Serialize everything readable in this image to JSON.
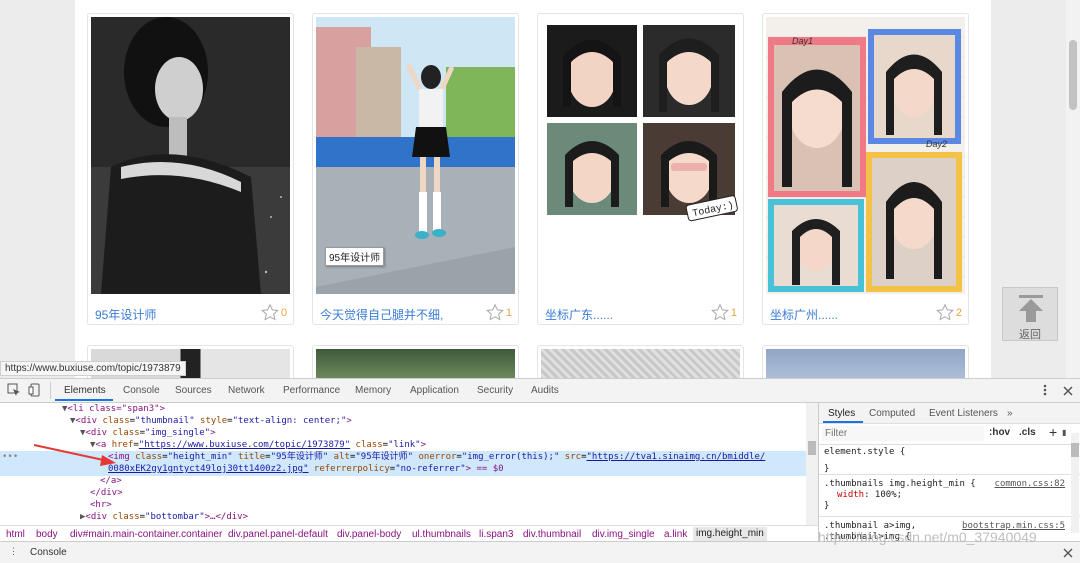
{
  "cards": [
    {
      "caption": "95年设计师",
      "count": "0"
    },
    {
      "caption": "今天觉得自己腿并不细,",
      "count": "1"
    },
    {
      "caption": "坐标广东......",
      "count": "1"
    },
    {
      "caption": "坐标广州......",
      "count": "2"
    }
  ],
  "tooltip": "95年设计师",
  "back_button": "返回",
  "status_url": "https://www.buxiuse.com/topic/1973879",
  "photo_text": {
    "day1": "Day1",
    "day2": "Day2",
    "today": "Today:)"
  },
  "devtools": {
    "tabs": [
      "Elements",
      "Console",
      "Sources",
      "Network",
      "Performance",
      "Memory",
      "Application",
      "Security",
      "Audits"
    ],
    "dom": {
      "l1_tag": "<li class=\"span3\">",
      "l2_open": "<div ",
      "l2_a1": "class",
      "l2_v1": "\"thumbnail\"",
      "l2_a2": " style",
      "l2_v2": "\"text-align: center;\"",
      "l2_close": ">",
      "l3_open": "<div ",
      "l3_a1": "class",
      "l3_v1": "\"img_single\"",
      "l3_close": ">",
      "l4_open": "<a ",
      "l4_a1": "href",
      "l4_v1": "\"https://www.buxiuse.com/topic/1973879\"",
      "l4_a2": " class",
      "l4_v2": "\"link\"",
      "l4_close": ">",
      "l5_open": "<img ",
      "l5_a1": "class",
      "l5_v1": "\"height_min\"",
      "l5_a2": " title",
      "l5_v2": "\"95年设计师\"",
      "l5_a3": " alt",
      "l5_v3": "\"95年设计师\"",
      "l5_a4": " onerror",
      "l5_v4": "\"img_error(this);\"",
      "l5_a5": " src",
      "l5_v5": "\"https://tva1.sinaimg.cn/bmiddle/",
      "l6_link": "0080xEK2gy1gntyct49loj30tt1400z2.jpg\"",
      "l6_a1": " referrerpolicy",
      "l6_v1": "\"no-referrer\"",
      "l6_tail": "> == $0",
      "l7": "</a>",
      "l8": "</div>",
      "l9": "<hr>",
      "l10_open": "<div ",
      "l10_a1": "class",
      "l10_v1": "\"bottombar\"",
      "l10_close": ">…</div>"
    },
    "breadcrumbs": [
      "html",
      "body",
      "div#main.main-container.container",
      "div.panel.panel-default",
      "div.panel-body",
      "ul.thumbnails",
      "li.span3",
      "div.thumbnail",
      "div.img_single",
      "a.link",
      "img.height_min"
    ],
    "styles_tabs": [
      "Styles",
      "Computed",
      "Event Listeners"
    ],
    "filter_placeholder": "Filter",
    "filter_hov": ":hov",
    "filter_cls": ".cls",
    "rules": [
      {
        "selector": "element.style {",
        "body": "",
        "close": "}",
        "source": ""
      },
      {
        "selector": ".thumbnails img.height_min {",
        "body": "width: 100%;",
        "prop": "width",
        "value": " 100%;",
        "close": "}",
        "source": "common.css:82"
      },
      {
        "selector": ".thumbnail a>img,",
        "body": ".thumbnail>img {",
        "close": "",
        "source": "bootstrap.min.css:5"
      }
    ],
    "console_label": "Console"
  },
  "watermark": "https://blog.csdn.net/m0_37940049",
  "colors": {
    "link": "#3a7bd5",
    "tag": "#881280",
    "attr": "#994500",
    "value": "#1a1aa6",
    "highlight": "#cfe8fc",
    "accent": "#1a73e8",
    "arrow": "#e53935"
  }
}
